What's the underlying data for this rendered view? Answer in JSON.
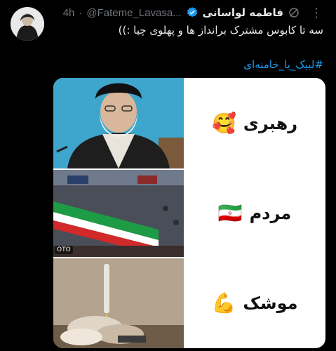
{
  "author": {
    "display_name": "فاطمه لواسانی",
    "handle": "@Fateme_Lavasa...",
    "time": "4h"
  },
  "tweet": {
    "text": "سه تا کابوس مشترک برانداز ها و پهلوی چیا :))",
    "hashtag": "#لبیک_یا_خامنه‌ای"
  },
  "media": {
    "rows": [
      {
        "label": "رهبری",
        "emoji": "🥰"
      },
      {
        "label": "مردم",
        "emoji": "🇮🇷"
      },
      {
        "label": "موشک",
        "emoji": "💪"
      }
    ],
    "watermark": "OTO"
  },
  "icons": {
    "verified": "verified-badge-icon",
    "grok": "slashed-circle-icon",
    "more": "more-options-icon"
  },
  "colors": {
    "accent": "#1d9bf0",
    "secondary_text": "#71767b",
    "background": "#000000"
  }
}
